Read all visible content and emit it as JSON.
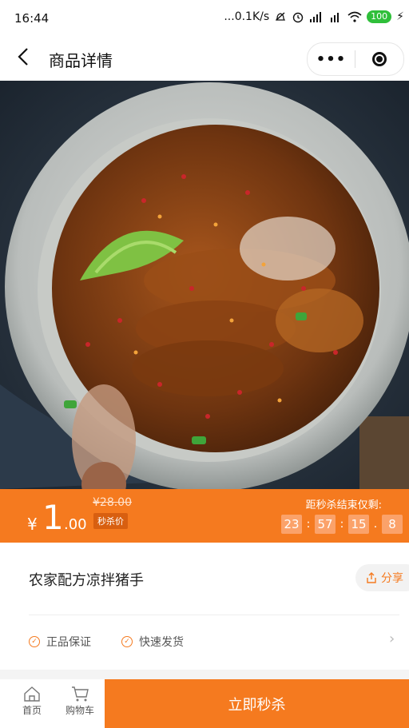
{
  "status_bar": {
    "time": "16:44",
    "network_speed": "...0.1K/s",
    "battery": "100"
  },
  "nav": {
    "title": "商品详情",
    "more_icon": "more-dots-icon",
    "target_icon": "target-icon"
  },
  "product": {
    "image_alt_icon": "food-photo",
    "name": "农家配方凉拌猪手"
  },
  "seckill": {
    "currency": "¥",
    "price_integer": "1",
    "price_decimal": ".00",
    "original_price": "¥28.00",
    "tag": "秒杀价",
    "countdown_label": "距秒杀结束仅剩:",
    "countdown": [
      "23",
      "57",
      "15",
      "8"
    ]
  },
  "share": {
    "label": "分享"
  },
  "guarantees": [
    "正品保证",
    "快速发货"
  ],
  "bottom_bar": {
    "home_label": "首页",
    "cart_label": "购物车",
    "buy_label": "立即秒杀"
  },
  "colors": {
    "accent": "#f57a1f",
    "battery": "#2fbf3a"
  }
}
